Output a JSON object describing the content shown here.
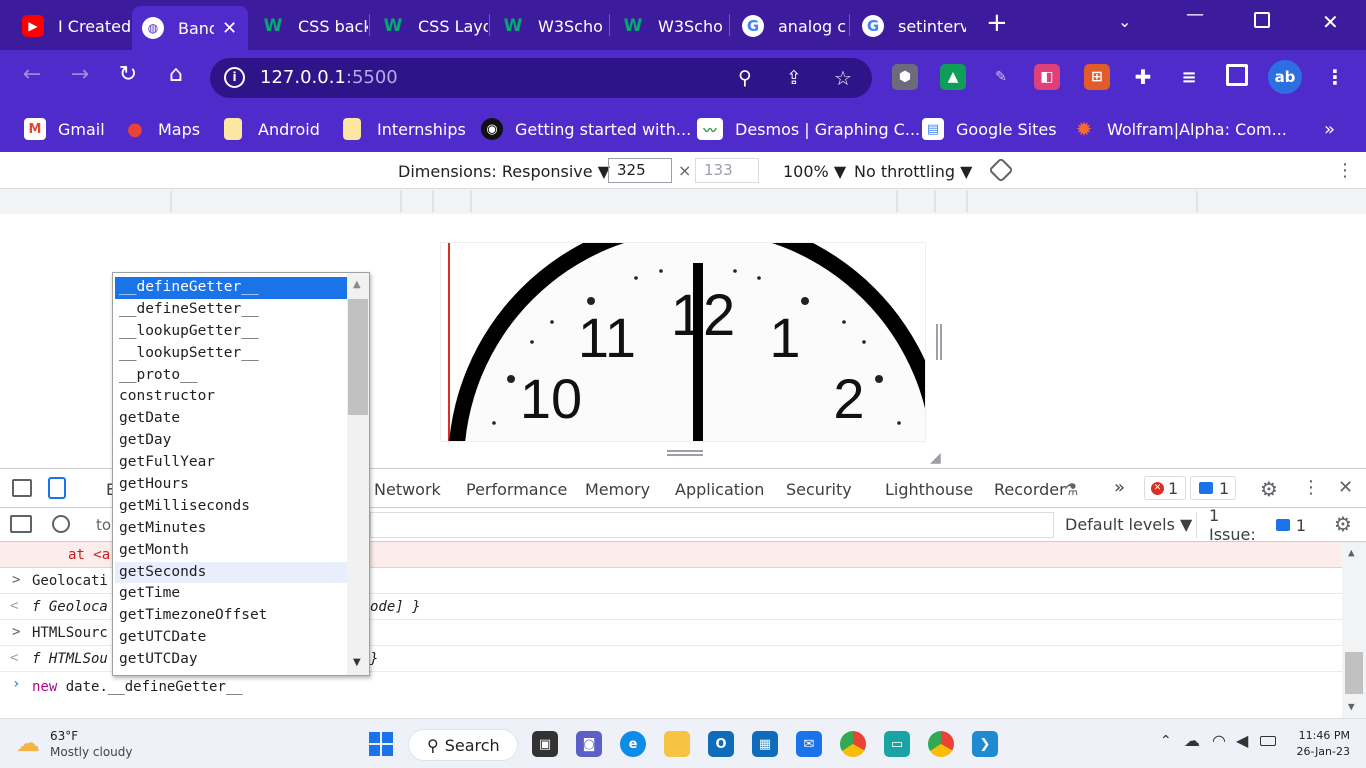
{
  "tabs": [
    {
      "title": "I Created",
      "icon": "youtube-icon"
    },
    {
      "title": "Band",
      "icon": "globe-icon"
    },
    {
      "title": "CSS back",
      "icon": "w3schools-icon"
    },
    {
      "title": "CSS Layo",
      "icon": "w3schools-icon"
    },
    {
      "title": "W3Scho",
      "icon": "w3schools-icon"
    },
    {
      "title": "W3Scho",
      "icon": "w3schools-icon"
    },
    {
      "title": "analog c",
      "icon": "google-icon"
    },
    {
      "title": "setinterv",
      "icon": "google-icon"
    }
  ],
  "address": {
    "host": "127.0.0.1",
    "port": ":5500"
  },
  "bookmarks": [
    {
      "label": "Gmail",
      "icon": "gmail-icon"
    },
    {
      "label": "Maps",
      "icon": "maps-icon"
    },
    {
      "label": "Android",
      "icon": "folder-icon"
    },
    {
      "label": "Internships",
      "icon": "folder-icon"
    },
    {
      "label": "Getting started with...",
      "icon": "github-icon"
    },
    {
      "label": "Desmos | Graphing C...",
      "icon": "desmos-icon"
    },
    {
      "label": "Google Sites",
      "icon": "google-sites-icon"
    },
    {
      "label": "Wolfram|Alpha: Com...",
      "icon": "wolfram-icon"
    }
  ],
  "device_toolbar": {
    "dimensions": "Dimensions: Responsive ▼",
    "width": "325",
    "height": "133",
    "times": "×",
    "zoom": "100% ▼",
    "throttling": "No throttling ▼"
  },
  "clock": {
    "numbers": [
      "12",
      "11",
      "1",
      "10",
      "2"
    ]
  },
  "devtools_tabs": [
    "E",
    "Network",
    "Performance",
    "Memory",
    "Application",
    "Security",
    "Lighthouse",
    "Recorder"
  ],
  "devtools_status": {
    "errors": "1",
    "messages": "1"
  },
  "console_toolbar": {
    "filter_value": "to",
    "levels": "Default levels ▼",
    "issues_label": "1 Issue:",
    "issues_count": "1"
  },
  "console_rows": [
    {
      "prefix": "",
      "text": "at <a",
      "style": "error"
    },
    {
      "prefix": ">",
      "text": "Geolocati",
      "style": "plain"
    },
    {
      "prefix": "<",
      "text": "f Geoloca",
      "tail": "ode] }",
      "style": "italic"
    },
    {
      "prefix": ">",
      "text": "HTMLSourc",
      "style": "plain"
    },
    {
      "prefix": "<",
      "text": "f HTMLSou",
      "tail": "}",
      "style": "italic"
    }
  ],
  "console_input": {
    "keyword": "new",
    "rest": " date.__defineGetter__"
  },
  "autocomplete": [
    "__defineGetter__",
    "__defineSetter__",
    "__lookupGetter__",
    "__lookupSetter__",
    "__proto__",
    "constructor",
    "getDate",
    "getDay",
    "getFullYear",
    "getHours",
    "getMilliseconds",
    "getMinutes",
    "getMonth",
    "getSeconds",
    "getTime",
    "getTimezoneOffset",
    "getUTCDate",
    "getUTCDay"
  ],
  "autocomplete_selected": 0,
  "autocomplete_hover": 13,
  "taskbar": {
    "weather_temp": "63°F",
    "weather_desc": "Mostly cloudy",
    "search": "Search",
    "time": "11:46 PM",
    "date": "26-Jan-23"
  },
  "colors": {
    "chrome_frame": "#3c1c9c",
    "chrome_toolbar": "#4f2bcc",
    "accent": "#1a73e8",
    "error": "#d93025"
  }
}
